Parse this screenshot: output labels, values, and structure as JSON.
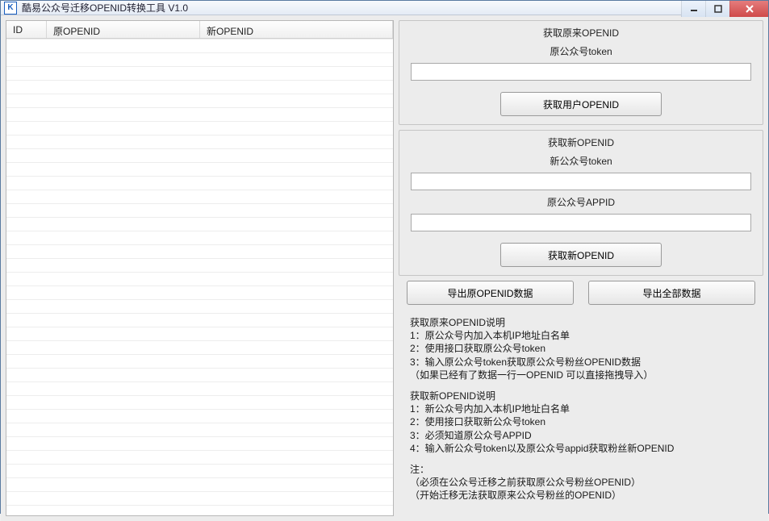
{
  "window": {
    "title": "酷易公众号迁移OPENID转换工具 V1.0",
    "icon_text": "K"
  },
  "table": {
    "columns": {
      "id": "ID",
      "old_openid": "原OPENID",
      "new_openid": "新OPENID"
    }
  },
  "right": {
    "section1": {
      "title": "获取原来OPENID",
      "token_label": "原公众号token",
      "token_value": "",
      "button": "获取用户OPENID"
    },
    "section2": {
      "title": "获取新OPENID",
      "new_token_label": "新公众号token",
      "new_token_value": "",
      "old_appid_label": "原公众号APPID",
      "old_appid_value": "",
      "button": "获取新OPENID"
    },
    "export": {
      "export_old": "导出原OPENID数据",
      "export_all": "导出全部数据"
    },
    "instructions": {
      "block1_title": "获取原来OPENID说明",
      "block1_line1": "1：原公众号内加入本机IP地址白名单",
      "block1_line2": "2：使用接口获取原公众号token",
      "block1_line3": "3：输入原公众号token获取原公众号粉丝OPENID数据",
      "block1_line4": "（如果已经有了数据一行一OPENID 可以直接拖拽导入）",
      "block2_title": "获取新OPENID说明",
      "block2_line1": "1：新公众号内加入本机IP地址白名单",
      "block2_line2": "2：使用接口获取新公众号token",
      "block2_line3": "3：必须知道原公众号APPID",
      "block2_line4": "4：输入新公众号token以及原公众号appid获取粉丝新OPENID",
      "block3_title": "注：",
      "block3_line1": "（必须在公众号迁移之前获取原公众号粉丝OPENID）",
      "block3_line2": "（开始迁移无法获取原来公众号粉丝的OPENID）"
    }
  }
}
